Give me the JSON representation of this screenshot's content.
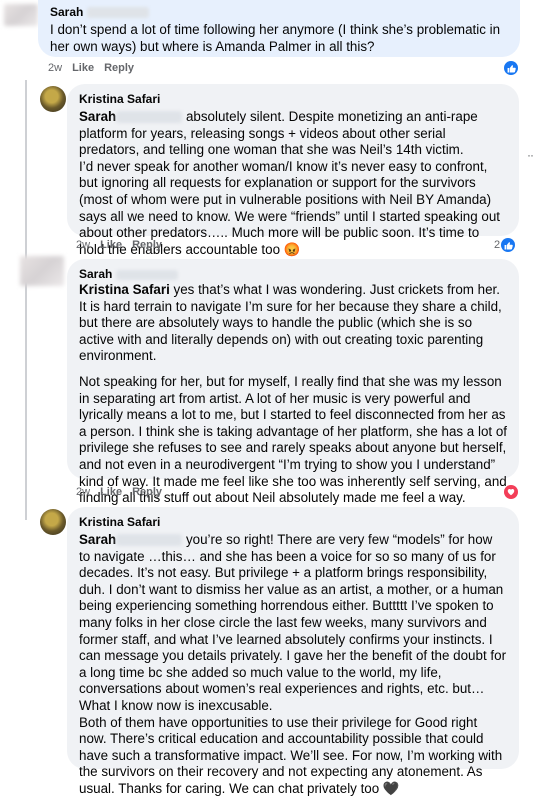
{
  "comments": [
    {
      "author": "Sarah",
      "text": "I don’t spend a lot of time following her anymore (I think she’s problematic in her own ways) but where is Amanda Palmer in all this?",
      "time": "2w",
      "like_label": "Like",
      "reply_label": "Reply"
    },
    {
      "author": "Kristina Safari",
      "mention": "Sarah",
      "p1": " absolutely silent. Despite monetizing an anti-rape platform for years, releasing songs + videos about other serial predators, and telling one woman that she was Neil’s 14th victim.",
      "p2": "I’d never speak for another woman/I know it’s never easy to confront, but ignoring all requests for explanation or support for the survivors (most of whom were put in vulnerable positions with Neil BY Amanda) says all we need to know. We were “friends” until I started speaking out about other predators….. Much more will be public soon. It’s time to hold the enablers accountable too 😡",
      "time": "2w",
      "like_label": "Like",
      "reply_label": "Reply",
      "reaction_count": "2"
    },
    {
      "author": "Sarah",
      "mention": "Kristina Safari",
      "p1": " yes that’s what I was wondering. Just crickets from her. It is hard terrain to navigate I’m sure for her because they share a child, but there are absolutely ways to handle the public (which she is so active with and literally depends on) with out creating toxic parenting environment.",
      "p2": "Not speaking for her, but for myself, I really find that she was my lesson in separating art from artist. A lot of her music is very powerful and lyrically means a lot to me, but I started to feel disconnected from her as a person. I think she is taking advantage of her platform, she has a lot of privilege she refuses to see and rarely speaks about anyone but herself, and not even in a neurodivergent “I’m trying to show you I understand” kind of way. It made me feel like she too was inherently self serving, and finding all this stuff out about Neil absolutely made me feel a way.",
      "time": "2w",
      "like_label": "Like",
      "reply_label": "Reply"
    },
    {
      "author": "Kristina Safari",
      "mention": "Sarah",
      "p1": " you’re so right! There are very few “models” for how to navigate …this… and she has been a voice for so so many of us for decades. It’s not easy. But privilege + a platform brings responsibility, duh. I don’t want to dismiss her value as an artist, a mother, or a human being experiencing something horrendous either. Buttttt I’ve spoken to many folks in her close circle the last few weeks, many survivors and former staff, and what I’ve learned absolutely confirms your instincts. I can message you details privately. I gave her the benefit of the doubt for a long time bc she added so much value to the world, my life, conversations about women’s real experiences and rights, etc. but… What I know now is inexcusable.",
      "p2": "Both of them have opportunities to use their privilege for Good right now. There’s critical education and accountability possible that could have such a transformative impact. We’ll see. For now, I’m working with the survivors on their recovery and not expecting any atonement. As usual. Thanks for caring. We can chat privately too 🖤"
    }
  ],
  "more_options": "··",
  "colors": {
    "like": "#1877f2",
    "love": "#f33e58",
    "bubble": "#f0f2f5",
    "highlight": "#e7f0fd"
  },
  "icons": {
    "like": "thumbs-up-icon",
    "love": "heart-icon",
    "more": "more-options-icon"
  }
}
